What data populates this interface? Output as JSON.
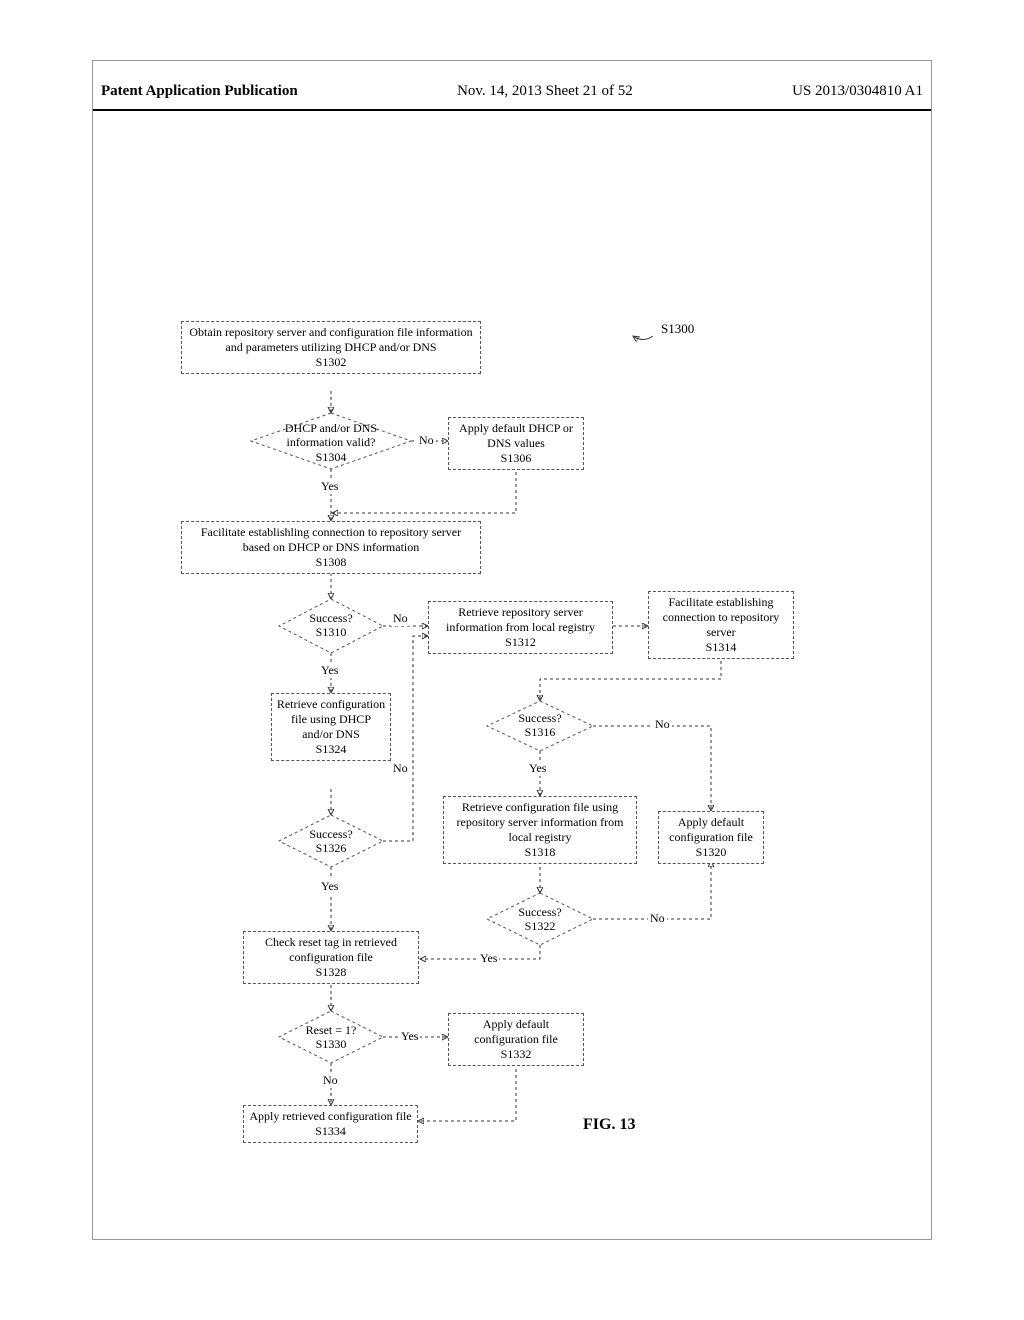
{
  "header": {
    "left": "Patent Application Publication",
    "center": "Nov. 14, 2013  Sheet 21 of 52",
    "right": "US 2013/0304810 A1"
  },
  "refTag": "S1300",
  "figLabel": "FIG. 13",
  "labels": {
    "yes": "Yes",
    "no": "No"
  },
  "nodes": {
    "s1302": {
      "text": "Obtain repository server and configuration file information\nand parameters utilizing DHCP and/or DNS",
      "id": "S1302"
    },
    "s1304": {
      "text": "DHCP and/or DNS information valid?",
      "id": "S1304"
    },
    "s1306": {
      "text": "Apply default DHCP or DNS values",
      "id": "S1306"
    },
    "s1308": {
      "text": "Facilitate establishling connection to repository server based on DHCP or DNS information",
      "id": "S1308"
    },
    "s1310": {
      "text": "Success?",
      "id": "S1310"
    },
    "s1312": {
      "text": "Retrieve repository server information from local registry",
      "id": "S1312"
    },
    "s1314": {
      "text": "Facilitate establishing connection to repository server",
      "id": "S1314"
    },
    "s1316": {
      "text": "Success?",
      "id": "S1316"
    },
    "s1318": {
      "text": "Retrieve configuration file using repository server information from local registry",
      "id": "S1318"
    },
    "s1320": {
      "text": "Apply default configuration file",
      "id": "S1320"
    },
    "s1322": {
      "text": "Success?",
      "id": "S1322"
    },
    "s1324": {
      "text": "Retrieve configuration file using DHCP and/or DNS",
      "id": "S1324"
    },
    "s1326": {
      "text": "Success?",
      "id": "S1326"
    },
    "s1328": {
      "text": "Check reset tag in retrieved configuration file",
      "id": "S1328"
    },
    "s1330": {
      "text": "Reset = 1?",
      "id": "S1330"
    },
    "s1332": {
      "text": "Apply default configuration file",
      "id": "S1332"
    },
    "s1334": {
      "text": "Apply retrieved configuration file",
      "id": "S1334"
    }
  }
}
